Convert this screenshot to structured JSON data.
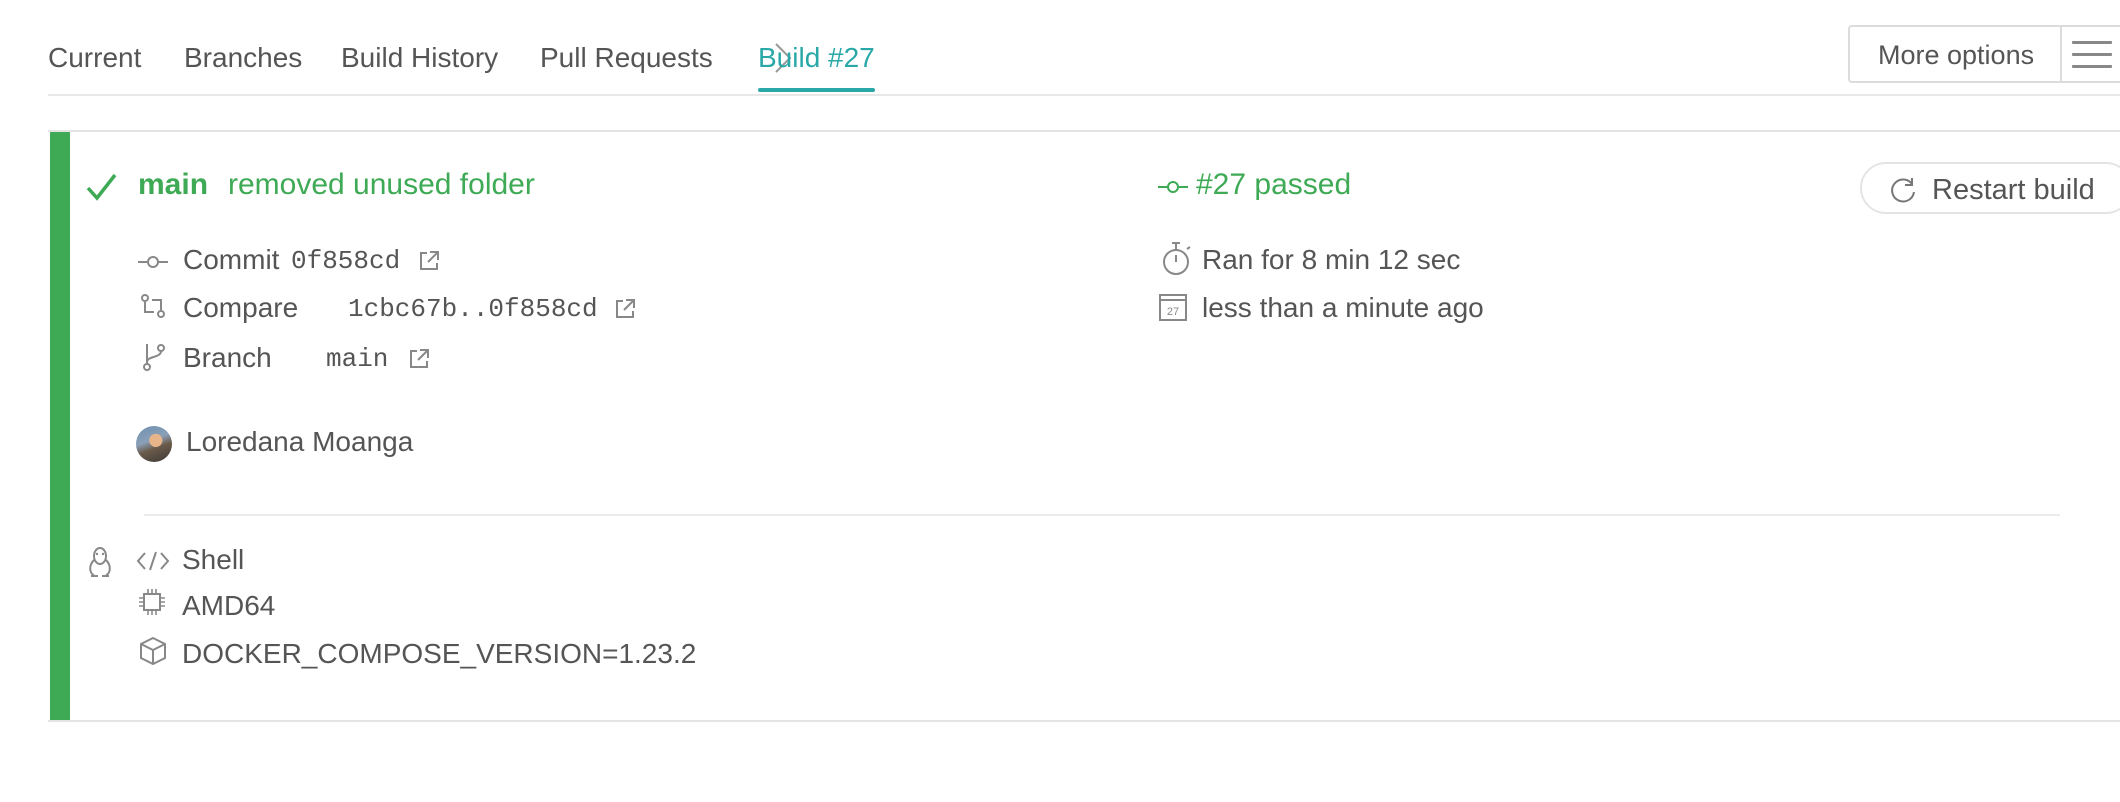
{
  "nav": {
    "tabs": [
      "Current",
      "Branches",
      "Build History",
      "Pull Requests"
    ],
    "active_tab": "Build #27",
    "more_options_label": "More options"
  },
  "build": {
    "branch": "main",
    "commit_message": "removed unused folder",
    "status_text": "#27 passed",
    "restart_label": "Restart build",
    "commit_label": "Commit",
    "commit_sha": "0f858cd",
    "compare_label": "Compare",
    "compare_range": "1cbc67b..0f858cd",
    "branch_label": "Branch",
    "branch_name": "main",
    "author": "Loredana Moanga",
    "duration": "Ran for 8 min 12 sec",
    "finished": "less than a minute ago",
    "calendar_day": "27",
    "status_color": "#3eaa55"
  },
  "job": {
    "language": "Shell",
    "arch": "AMD64",
    "env": "DOCKER_COMPOSE_VERSION=1.23.2"
  }
}
